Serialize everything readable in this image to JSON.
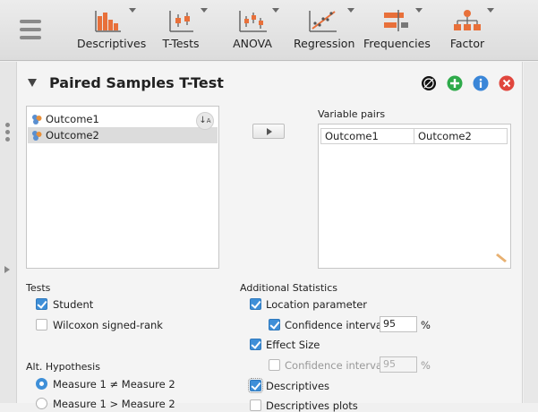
{
  "toolbar": {
    "items": [
      {
        "label": "Descriptives",
        "icon": "descriptives-icon"
      },
      {
        "label": "T-Tests",
        "icon": "t-tests-icon"
      },
      {
        "label": "ANOVA",
        "icon": "anova-icon"
      },
      {
        "label": "Regression",
        "icon": "regression-icon"
      },
      {
        "label": "Frequencies",
        "icon": "frequencies-icon"
      },
      {
        "label": "Factor",
        "icon": "factor-icon"
      }
    ]
  },
  "analysis": {
    "title": "Paired Samples T-Test",
    "variables": [
      "Outcome1",
      "Outcome2"
    ],
    "selected_variable": "Outcome2",
    "pairs_label": "Variable pairs",
    "pairs": [
      [
        "Outcome1",
        "Outcome2"
      ]
    ]
  },
  "tests": {
    "heading": "Tests",
    "student": {
      "label": "Student",
      "checked": true
    },
    "wilcoxon": {
      "label": "Wilcoxon signed-rank",
      "checked": false
    }
  },
  "hypothesis": {
    "heading": "Alt. Hypothesis",
    "options": [
      "Measure 1 ≠ Measure 2",
      "Measure 1 > Measure 2"
    ],
    "selected": 0
  },
  "additional": {
    "heading": "Additional Statistics",
    "location": {
      "label": "Location parameter",
      "checked": true
    },
    "location_ci": {
      "label": "Confidence interval",
      "checked": true,
      "value": "95",
      "unit": "%"
    },
    "effect_size": {
      "label": "Effect Size",
      "checked": true
    },
    "effect_ci": {
      "label": "Confidence interval",
      "checked": false,
      "value": "95",
      "unit": "%"
    },
    "descriptives": {
      "label": "Descriptives",
      "checked": true
    },
    "descriptives_plots": {
      "label": "Descriptives plots",
      "checked": false
    }
  },
  "colors": {
    "accent": "#3e8fd8",
    "add": "#2eaa4a",
    "info": "#3a86d8",
    "close": "#e0463d",
    "toolbar_icon": "#e8703a"
  }
}
